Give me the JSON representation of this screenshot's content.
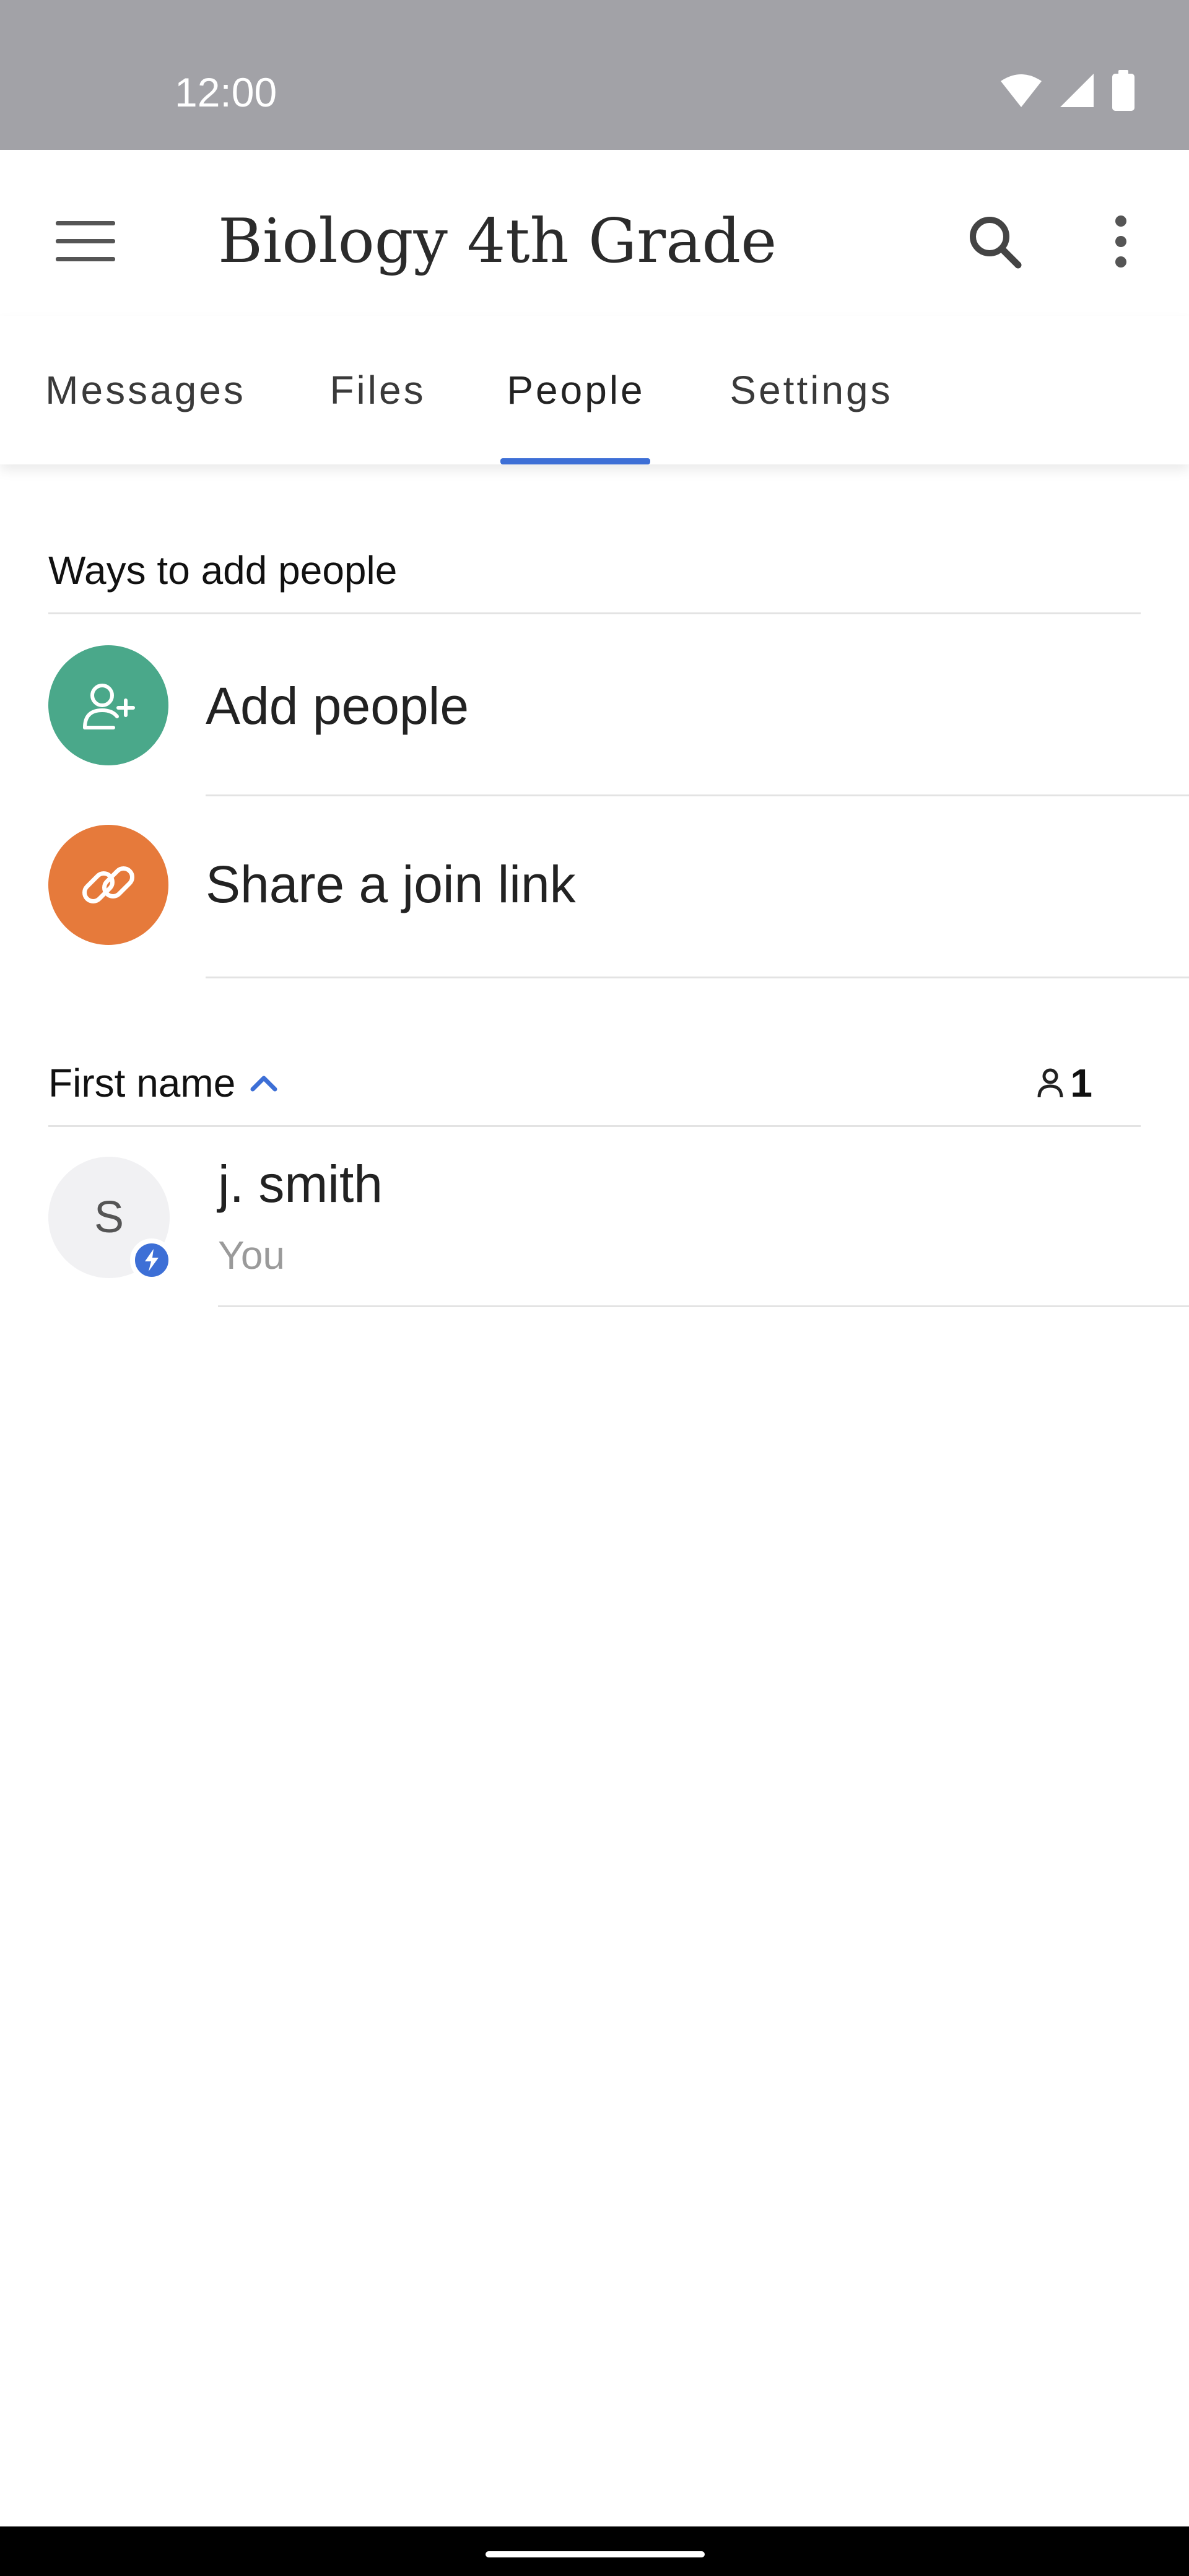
{
  "status_bar": {
    "time": "12:00"
  },
  "app_bar": {
    "title": "Biology 4th Grade",
    "menu_icon": "hamburger-menu-icon",
    "search_icon": "search-icon",
    "more_icon": "more-vertical-icon"
  },
  "tabs": [
    {
      "label": "Messages",
      "selected": false
    },
    {
      "label": "Files",
      "selected": false
    },
    {
      "label": "People",
      "selected": true
    },
    {
      "label": "Settings",
      "selected": false
    }
  ],
  "add_section": {
    "header": "Ways to add people",
    "items": [
      {
        "label": "Add people",
        "icon": "add-person-icon",
        "color": "#4aa88a"
      },
      {
        "label": "Share a join link",
        "icon": "link-icon",
        "color": "#e67a3b"
      }
    ]
  },
  "people_section": {
    "sort_label": "First name",
    "sort_direction": "ascending",
    "member_count": "1",
    "members": [
      {
        "avatar_initial": "S",
        "name": "j. smith",
        "subtitle": "You"
      }
    ]
  },
  "colors": {
    "accent": "#3d6fd6",
    "status_bar": "#a2a2a7"
  }
}
